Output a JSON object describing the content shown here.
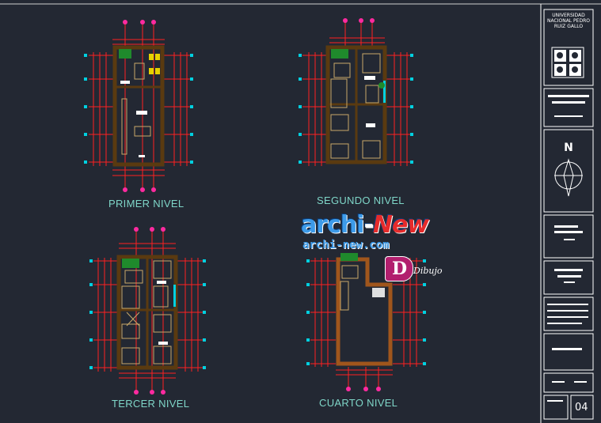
{
  "plans": [
    {
      "name": "PRIMER NIVEL"
    },
    {
      "name": "SEGUNDO NIVEL"
    },
    {
      "name": "TERCER NIVEL"
    },
    {
      "name": "CUARTO NIVEL"
    }
  ],
  "title_block": {
    "institution": "UNIVERSIDAD NACIONAL PEDRO RUIZ GALLO",
    "north_letter": "N",
    "sheet_number": "04"
  },
  "watermark": {
    "brand_main": "archi",
    "brand_accent": "New",
    "site": "archi-new.com",
    "logo_letter": "D",
    "logo_text": "Dibujo"
  },
  "colors": {
    "background": "#232833",
    "dimension_red": "#ff2020",
    "label_cyan": "#7fd6c8",
    "wall_brown": "#5a3a10",
    "magenta_marker": "#ff2aa0"
  }
}
